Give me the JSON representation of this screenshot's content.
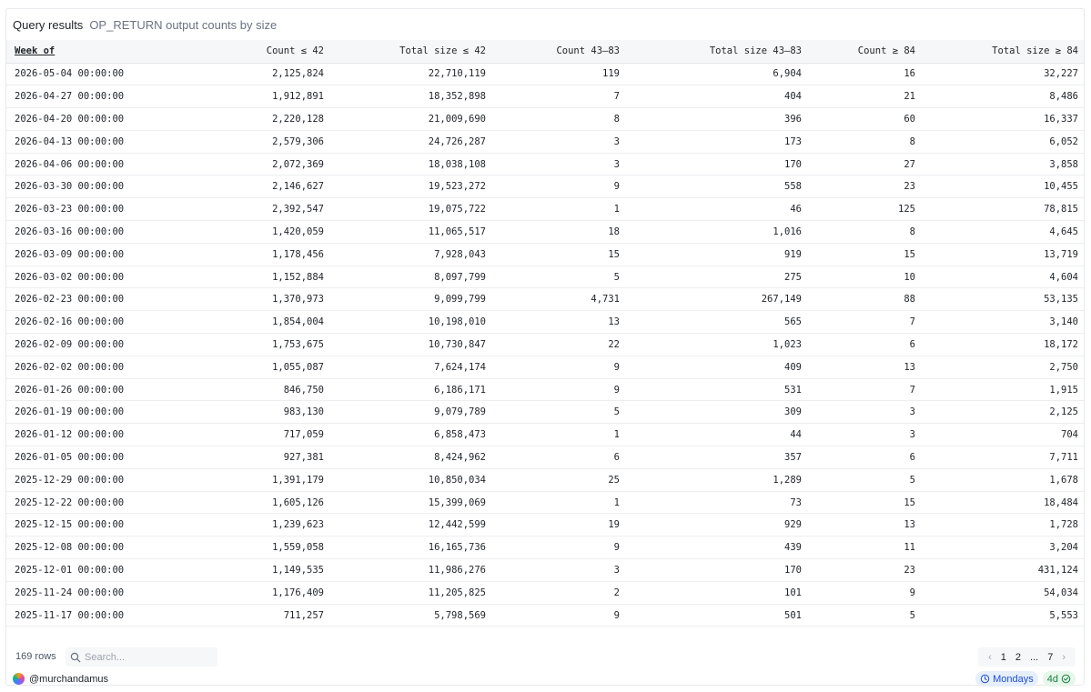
{
  "header": {
    "title": "Query results",
    "subtitle": "OP_RETURN output counts by size"
  },
  "table": {
    "columns": [
      "Week of",
      "Count ≤ 42",
      "Total size ≤ 42",
      "Count 43–83",
      "Total size 43–83",
      "Count ≥ 84",
      "Total size ≥ 84"
    ],
    "rows": [
      [
        "2026-05-04 00:00:00",
        "2,125,824",
        "22,710,119",
        "119",
        "6,904",
        "16",
        "32,227"
      ],
      [
        "2026-04-27 00:00:00",
        "1,912,891",
        "18,352,898",
        "7",
        "404",
        "21",
        "8,486"
      ],
      [
        "2026-04-20 00:00:00",
        "2,220,128",
        "21,009,690",
        "8",
        "396",
        "60",
        "16,337"
      ],
      [
        "2026-04-13 00:00:00",
        "2,579,306",
        "24,726,287",
        "3",
        "173",
        "8",
        "6,052"
      ],
      [
        "2026-04-06 00:00:00",
        "2,072,369",
        "18,038,108",
        "3",
        "170",
        "27",
        "3,858"
      ],
      [
        "2026-03-30 00:00:00",
        "2,146,627",
        "19,523,272",
        "9",
        "558",
        "23",
        "10,455"
      ],
      [
        "2026-03-23 00:00:00",
        "2,392,547",
        "19,075,722",
        "1",
        "46",
        "125",
        "78,815"
      ],
      [
        "2026-03-16 00:00:00",
        "1,420,059",
        "11,065,517",
        "18",
        "1,016",
        "8",
        "4,645"
      ],
      [
        "2026-03-09 00:00:00",
        "1,178,456",
        "7,928,043",
        "15",
        "919",
        "15",
        "13,719"
      ],
      [
        "2026-03-02 00:00:00",
        "1,152,884",
        "8,097,799",
        "5",
        "275",
        "10",
        "4,604"
      ],
      [
        "2026-02-23 00:00:00",
        "1,370,973",
        "9,099,799",
        "4,731",
        "267,149",
        "88",
        "53,135"
      ],
      [
        "2026-02-16 00:00:00",
        "1,854,004",
        "10,198,010",
        "13",
        "565",
        "7",
        "3,140"
      ],
      [
        "2026-02-09 00:00:00",
        "1,753,675",
        "10,730,847",
        "22",
        "1,023",
        "6",
        "18,172"
      ],
      [
        "2026-02-02 00:00:00",
        "1,055,087",
        "7,624,174",
        "9",
        "409",
        "13",
        "2,750"
      ],
      [
        "2026-01-26 00:00:00",
        "846,750",
        "6,186,171",
        "9",
        "531",
        "7",
        "1,915"
      ],
      [
        "2026-01-19 00:00:00",
        "983,130",
        "9,079,789",
        "5",
        "309",
        "3",
        "2,125"
      ],
      [
        "2026-01-12 00:00:00",
        "717,059",
        "6,858,473",
        "1",
        "44",
        "3",
        "704"
      ],
      [
        "2026-01-05 00:00:00",
        "927,381",
        "8,424,962",
        "6",
        "357",
        "6",
        "7,711"
      ],
      [
        "2025-12-29 00:00:00",
        "1,391,179",
        "10,850,034",
        "25",
        "1,289",
        "5",
        "1,678"
      ],
      [
        "2025-12-22 00:00:00",
        "1,605,126",
        "15,399,069",
        "1",
        "73",
        "15",
        "18,484"
      ],
      [
        "2025-12-15 00:00:00",
        "1,239,623",
        "12,442,599",
        "19",
        "929",
        "13",
        "1,728"
      ],
      [
        "2025-12-08 00:00:00",
        "1,559,058",
        "16,165,736",
        "9",
        "439",
        "11",
        "3,204"
      ],
      [
        "2025-12-01 00:00:00",
        "1,149,535",
        "11,986,276",
        "3",
        "170",
        "23",
        "431,124"
      ],
      [
        "2025-11-24 00:00:00",
        "1,176,409",
        "11,205,825",
        "2",
        "101",
        "9",
        "54,034"
      ],
      [
        "2025-11-17 00:00:00",
        "711,257",
        "5,798,569",
        "9",
        "501",
        "5",
        "5,553"
      ]
    ]
  },
  "footer": {
    "row_count": "169 rows",
    "search_placeholder": "Search...",
    "pagination": {
      "prev": "‹",
      "pages": [
        "1",
        "2",
        "...",
        "7"
      ],
      "next": "›"
    },
    "author": "@murchandamus",
    "schedule": "Mondays",
    "age": "4d"
  },
  "icons": {
    "search": "search-icon",
    "schedule": "clock-icon",
    "age": "check-circle-icon"
  },
  "colors": {
    "schedule_badge": "#1d4ed8",
    "age_badge": "#15803d"
  }
}
